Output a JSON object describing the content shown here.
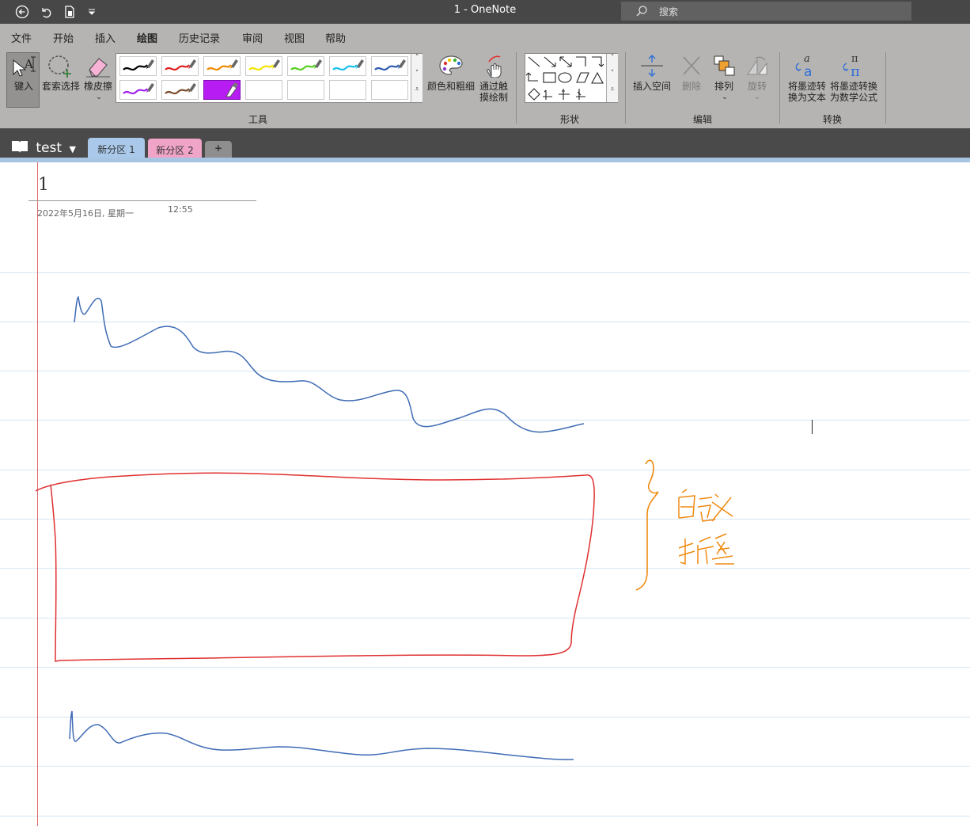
{
  "titlebar": {
    "title": "1  -  OneNote",
    "search_placeholder": "搜索",
    "back_icon": "back-arrow-icon",
    "undo_icon": "undo-icon",
    "quick_access_icon": "document-icon"
  },
  "menu": {
    "items": [
      "文件",
      "开始",
      "插入",
      "绘图",
      "历史记录",
      "审阅",
      "视图",
      "帮助"
    ],
    "active": "绘图"
  },
  "ribbon": {
    "type_label": "键入",
    "lasso_label": "套索选择",
    "eraser_label": "橡皮擦",
    "color_thickness_label": "颜色和粗细",
    "touch_draw_label_1": "通过触",
    "touch_draw_label_2": "摸绘制",
    "insert_space_label": "插入空间",
    "delete_label": "删除",
    "arrange_label": "排列",
    "rotate_label": "旋转",
    "ink_to_text_label_1": "将墨迹转",
    "ink_to_text_label_2": "换为文本",
    "ink_to_math_label_1": "将墨迹转换",
    "ink_to_math_label_2": "为数学公式",
    "groups": {
      "tools": "工具",
      "shapes": "形状",
      "edit": "编辑",
      "convert": "转换"
    },
    "pen_colors": [
      "#000000",
      "#e02020",
      "#f08a00",
      "#f2e400",
      "#55d020",
      "#18c0f0",
      "#2e5cb0",
      "#a020f0",
      "#7a4a2a",
      "#b71df2"
    ]
  },
  "notebook": {
    "name": "test",
    "sections": [
      {
        "label": "新分区 1",
        "color": "#a9c8ea"
      },
      {
        "label": "新分区 2",
        "color": "#f0a4c8"
      }
    ],
    "add_label": "+"
  },
  "page": {
    "title": "1",
    "date": "2022年5月16日, 星期一",
    "time": "12:55",
    "ink_text_line1": "自定义",
    "ink_text_line2": "折叠",
    "ink_colors": {
      "blue": "#3f6bb5",
      "red": "#e03030",
      "orange": "#f08a10",
      "margin": "#e06a6a",
      "rule": "#d4e6f4"
    }
  }
}
